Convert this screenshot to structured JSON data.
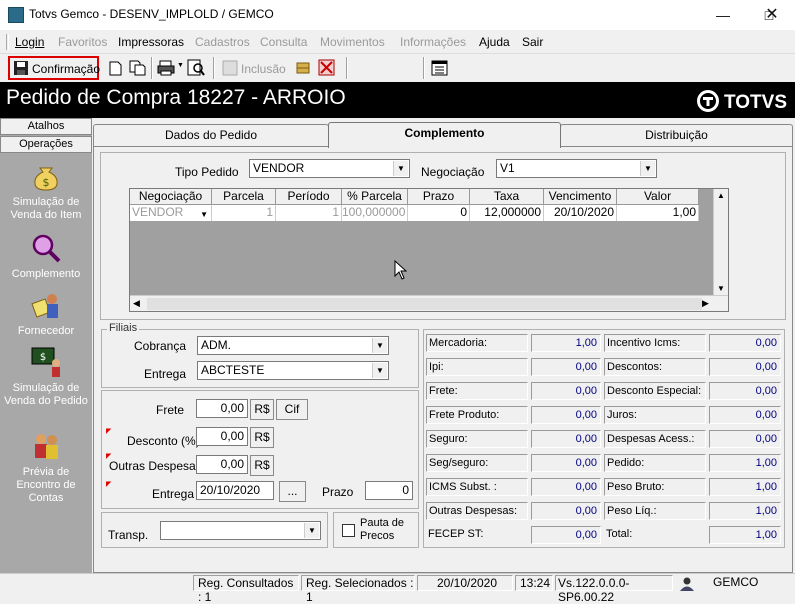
{
  "window": {
    "title": "Totvs Gemco - DESENV_IMPLOLD / GEMCO"
  },
  "menu": [
    "Login",
    "Favoritos",
    "Impressoras",
    "Cadastros",
    "Consulta",
    "Movimentos",
    "Informações",
    "Ajuda",
    "Sair"
  ],
  "toolbar": {
    "confirm_label": "Confirmação",
    "inclusao_label": "Inclusão"
  },
  "header": {
    "title": "Pedido de Compra  18227 - ARROIO",
    "logo": "TOTVS"
  },
  "left_panel": {
    "tabs": [
      "Atalhos",
      "Operações"
    ],
    "items": [
      "Simulação de Venda do Item",
      "Complemento",
      "Fornecedor",
      "Simulação de Venda do Pedido",
      "Prévia de Encontro de Contas"
    ]
  },
  "tabs": [
    "Dados do Pedido",
    "Complemento",
    "Distribuição"
  ],
  "form": {
    "tipo_pedido_label": "Tipo Pedido",
    "tipo_pedido_value": "VENDOR",
    "negociacao_label": "Negociação",
    "negociacao_value": "V1"
  },
  "grid": {
    "headers": [
      "Negociação",
      "Parcela",
      "Período",
      "% Parcela",
      "Prazo",
      "Taxa",
      "Vencimento",
      "Valor"
    ],
    "rows": [
      [
        "VENDOR",
        "1",
        "1",
        "100,000000",
        "0",
        "12,000000",
        "20/10/2020",
        "1,00"
      ]
    ]
  },
  "filiais": {
    "group_label": "Filiais",
    "cobranca_label": "Cobrança",
    "cobranca_value": "ADM.",
    "entrega_label": "Entrega",
    "entrega_value": "ABCTESTE"
  },
  "custos": {
    "frete_label": "Frete",
    "frete_value": "0,00",
    "desconto_label": "Desconto (%)",
    "desconto_value": "0,00",
    "outras_label": "Outras Despesas:",
    "outras_value": "0,00",
    "entrega_label": "Entrega",
    "entrega_value": "20/10/2020",
    "prazo_label": "Prazo",
    "prazo_value": "0",
    "rs_label": "R$",
    "cif_label": "Cif",
    "ellipsis_label": "..."
  },
  "transp": {
    "label": "Transp.",
    "value": "",
    "pauta_label": "Pauta de Precos"
  },
  "totals_left": [
    {
      "label": "Mercadoria:",
      "value": "1,00"
    },
    {
      "label": "Ipi:",
      "value": "0,00"
    },
    {
      "label": "Frete:",
      "value": "0,00"
    },
    {
      "label": "Frete Produto:",
      "value": "0,00"
    },
    {
      "label": "Seguro:",
      "value": "0,00"
    },
    {
      "label": "Seg/seguro:",
      "value": "0,00"
    },
    {
      "label": "ICMS Subst. :",
      "value": "0,00"
    },
    {
      "label": "Outras Despesas:",
      "value": "0,00"
    },
    {
      "label": "FECEP ST:",
      "value": "0,00"
    }
  ],
  "totals_right": [
    {
      "label": "Incentivo Icms:",
      "value": "0,00"
    },
    {
      "label": "Descontos:",
      "value": "0,00"
    },
    {
      "label": "Desconto Especial:",
      "value": "0,00"
    },
    {
      "label": "Juros:",
      "value": "0,00"
    },
    {
      "label": "Despesas Acess.:",
      "value": "0,00"
    },
    {
      "label": "Pedido:",
      "value": "1,00"
    },
    {
      "label": "Peso Bruto:",
      "value": "1,00"
    },
    {
      "label": "Peso Líq.:",
      "value": "1,00"
    },
    {
      "label": "Total:",
      "value": "1,00"
    }
  ],
  "status": {
    "reg_consultados": "Reg. Consultados : 1",
    "reg_selecionados": "Reg. Selecionados : 1",
    "date": "20/10/2020",
    "time": "13:24",
    "version": "Vs.122.0.0.0-SP6.00.22",
    "company": "GEMCO"
  }
}
